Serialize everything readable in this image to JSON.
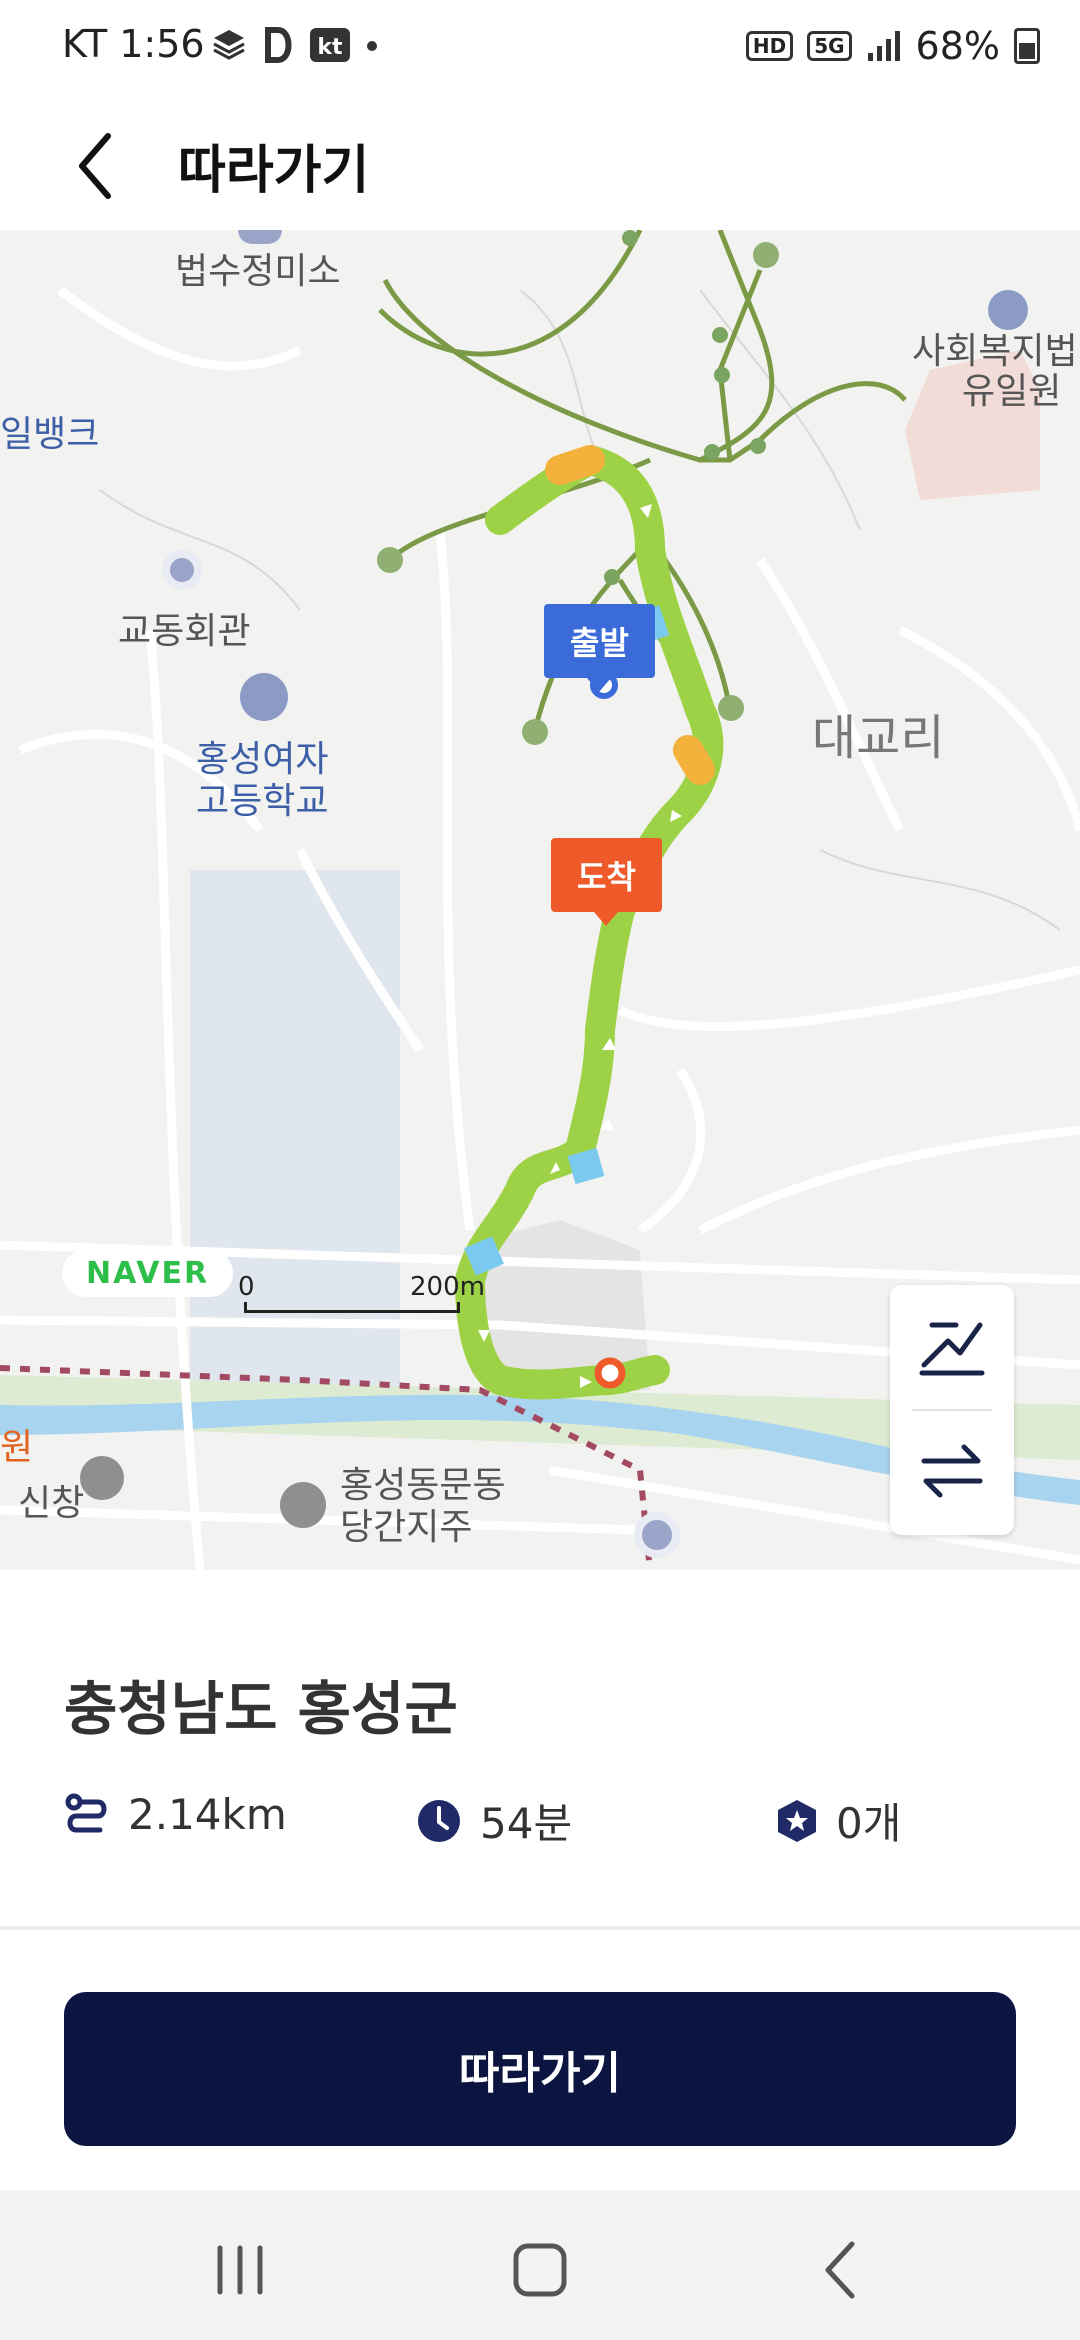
{
  "status_bar": {
    "time": "KT 1:56",
    "battery": "68%",
    "badges": [
      "HD",
      "5G"
    ]
  },
  "header": {
    "title": "따라가기",
    "back_icon": "chevron-left-icon"
  },
  "map": {
    "labels": {
      "temple": "법수정미소",
      "bank": "일뱅크",
      "welfare_line1": "사회복지법",
      "welfare_line2": "유일원",
      "hall": "교동회관",
      "school_line1": "홍성여자",
      "school_line2": "고등학교",
      "district": "대교리",
      "left_edge": "원",
      "shinchang": "신창",
      "shrine_line1": "홍성동문동",
      "shrine_line2": "당간지주"
    },
    "start_marker": "출발",
    "end_marker": "도착",
    "naver_logo": "NAVER",
    "scale_zero": "0",
    "scale_distance": "200m",
    "route_color": "#9ed246",
    "trail_color": "#7a9a45"
  },
  "map_tools": {
    "elevation_icon": "elevation-profile-icon",
    "swap_icon": "swap-direction-icon"
  },
  "summary": {
    "region": "충청남도 홍성군",
    "distance": "2.14km",
    "duration": "54분",
    "stamps": "0개"
  },
  "cta": {
    "label": "따라가기"
  },
  "nav": {
    "recent": "recent-apps-icon",
    "home": "home-icon",
    "back": "back-icon"
  }
}
